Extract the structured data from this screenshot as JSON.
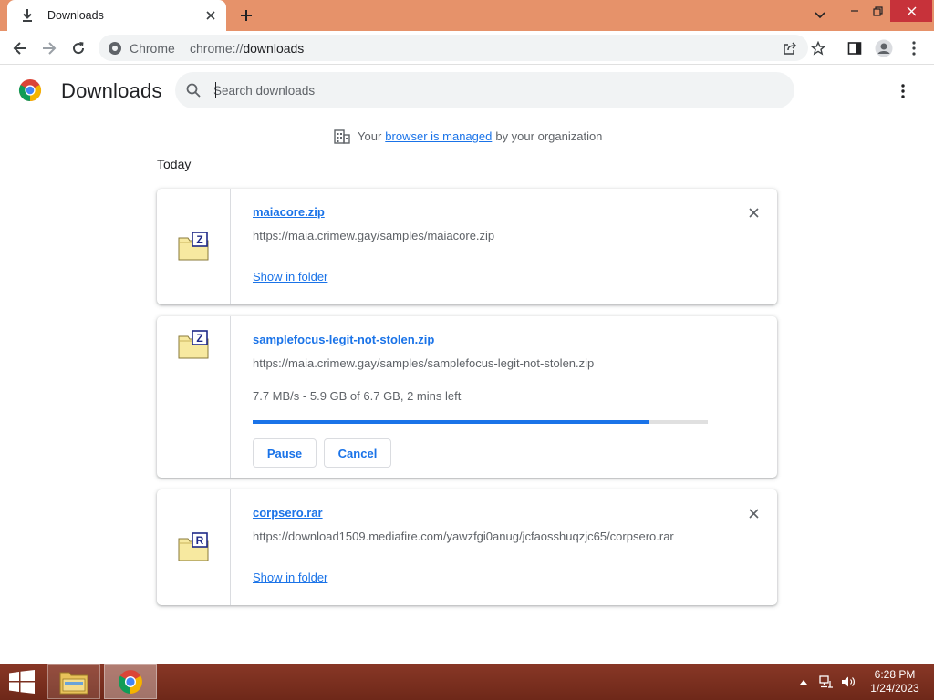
{
  "tab": {
    "title": "Downloads"
  },
  "omnibox": {
    "site": "Chrome",
    "url_scheme": "chrome://",
    "url_host": "downloads"
  },
  "page": {
    "title": "Downloads"
  },
  "search": {
    "placeholder": "Search downloads",
    "value": ""
  },
  "managed": {
    "prefix": "Your",
    "link": "browser is managed",
    "suffix": "by your organization"
  },
  "section": {
    "date": "Today"
  },
  "downloads": [
    {
      "filename": "maiacore.zip",
      "url": "https://maia.crimew.gay/samples/maiacore.zip",
      "icon": "zip-archive-icon",
      "icon_letter": "Z",
      "action_label": "Show in folder",
      "state": "complete"
    },
    {
      "filename": "samplefocus-legit-not-stolen.zip",
      "url": "https://maia.crimew.gay/samples/samplefocus-legit-not-stolen.zip",
      "icon": "zip-archive-icon",
      "icon_letter": "Z",
      "status": "7.7 MB/s - 5.9 GB of 6.7 GB, 2 mins left",
      "progress": 0.87,
      "pause_label": "Pause",
      "cancel_label": "Cancel",
      "state": "in-progress"
    },
    {
      "filename": "corpsero.rar",
      "url": "https://download1509.mediafire.com/yawzfgi0anug/jcfaosshuqzjc65/corpsero.rar",
      "icon": "rar-archive-icon",
      "icon_letter": "R",
      "action_label": "Show in folder",
      "state": "complete"
    }
  ],
  "taskbar": {
    "time": "6:28 PM",
    "date": "1/24/2023"
  },
  "colors": {
    "titlebar": "#e6926a",
    "accent": "#1a73e8",
    "taskbar": "#7f2f1f",
    "close": "#c7323a"
  }
}
